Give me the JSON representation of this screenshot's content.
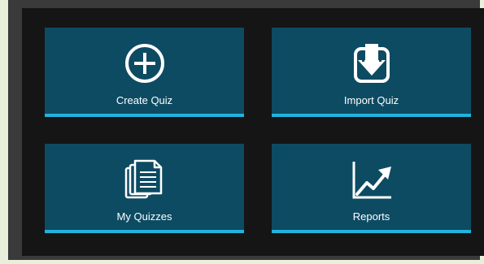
{
  "tiles": [
    {
      "label": "Create Quiz",
      "icon": "plus-circle-icon"
    },
    {
      "label": "Import Quiz",
      "icon": "download-icon"
    },
    {
      "label": "My Quizzes",
      "icon": "documents-icon"
    },
    {
      "label": "Reports",
      "icon": "trending-chart-icon"
    }
  ],
  "colors": {
    "tile_bg": "#0d4b63",
    "tile_accent": "#22b3dc",
    "panel_bg": "#151515",
    "frame_bg": "#3a3a3a",
    "page_bg": "#e8f0dc"
  }
}
